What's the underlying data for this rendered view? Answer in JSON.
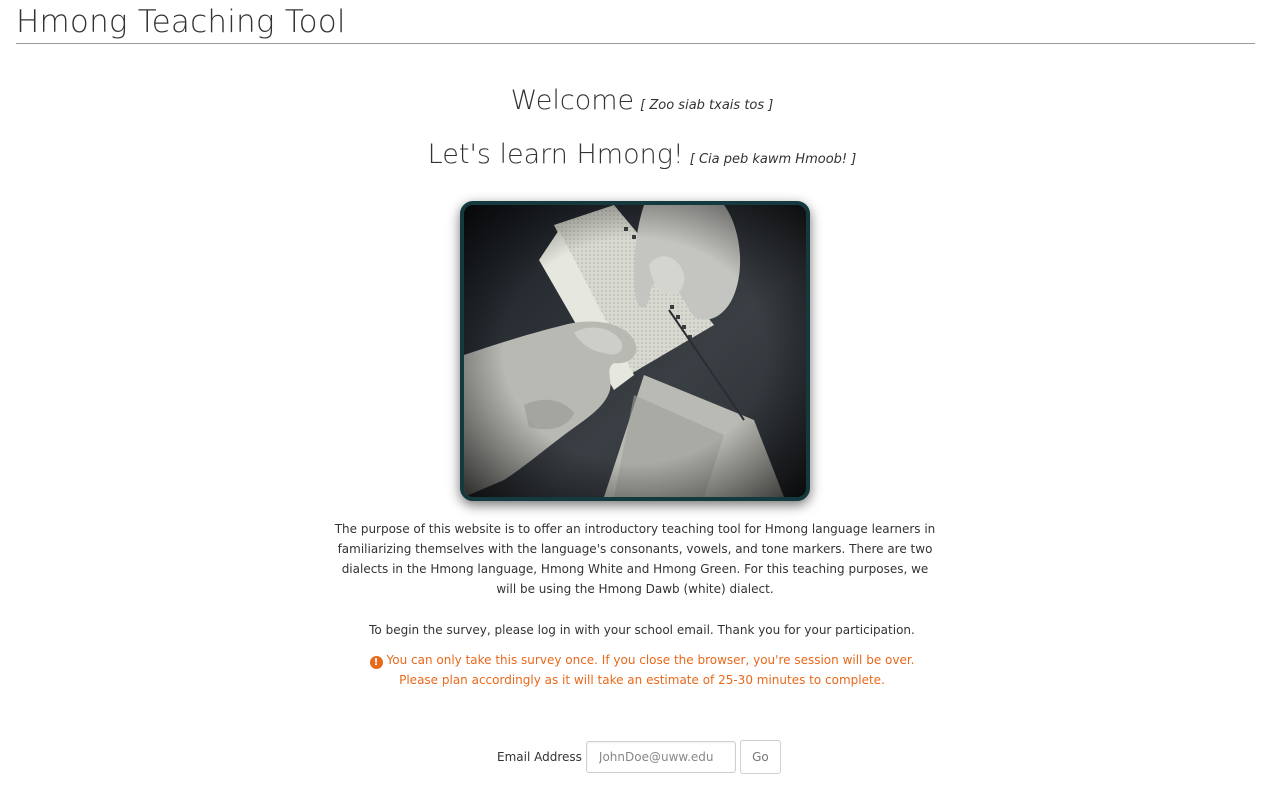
{
  "header": {
    "title": "Hmong Teaching Tool"
  },
  "welcome": {
    "heading": "Welcome",
    "translation": "[ Zoo siab txais tos ]"
  },
  "learn": {
    "heading": "Let's learn Hmong!",
    "translation": "[ Cia peb kawm Hmoob! ]"
  },
  "intro": {
    "text": "The purpose of this website is to offer an introductory teaching tool for Hmong language learners in familiarizing themselves with the language's consonants, vowels, and tone markers. There are two dialects in the Hmong language, Hmong White and Hmong Green. For this teaching purposes, we will be using the Hmong Dawb (white) dialect."
  },
  "instructions": {
    "text": "To begin the survey, please log in with your school email. Thank you for your participation."
  },
  "warning": {
    "icon": "exclamation-circle-icon",
    "line1": "You can only take this survey once. If you close the browser, you're session will be over.",
    "line2": "Please plan accordingly as it will take an estimate of 25-30 minutes to complete.",
    "color": "#e8691c"
  },
  "login": {
    "email_label": "Email Address",
    "email_placeholder": "JohnDoe@uww.edu",
    "email_value": "",
    "go_label": "Go"
  },
  "colors": {
    "frame_border": "#14393f",
    "text": "#333333"
  }
}
